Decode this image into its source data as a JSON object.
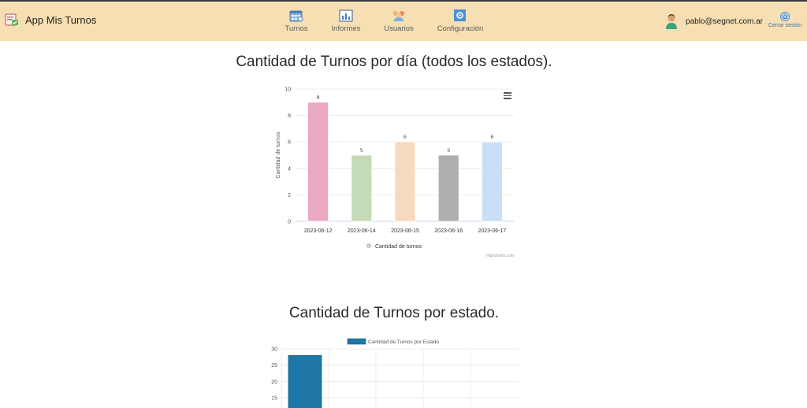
{
  "header": {
    "app_title": "App Mis Turnos",
    "nav": [
      {
        "label": "Turnos",
        "icon": "calendar-icon"
      },
      {
        "label": "Informes",
        "icon": "bar-chart-icon"
      },
      {
        "label": "Usuarios",
        "icon": "users-icon"
      },
      {
        "label": "Configuración",
        "icon": "gear-icon"
      }
    ],
    "user_email": "pablo@segnet.com.ar",
    "logout_label": "Cerrar sesión"
  },
  "colors": {
    "header_bg": "#f7dfb4",
    "link": "#3b6ea8",
    "bar_series2": "#1f77a8"
  },
  "sections": {
    "chart1_title": "Cantidad de Turnos por día (todos los estados).",
    "chart2_title": "Cantidad de Turnos por estado."
  },
  "chart_data": [
    {
      "type": "bar",
      "categories": [
        "2023-06-12",
        "2023-06-14",
        "2023-06-15",
        "2023-06-16",
        "2023-06-17"
      ],
      "series": [
        {
          "name": "Cantidad de turnos",
          "values": [
            9,
            5,
            6,
            5,
            6
          ]
        }
      ],
      "bar_colors": [
        "#e8a9c2",
        "#c5dbb8",
        "#f7d9bf",
        "#aeaeae",
        "#c8e0f5"
      ],
      "data_labels": [
        "9",
        "5",
        "6",
        "5",
        "6"
      ],
      "ylabel": "Cantidad de turnos",
      "yticks": [
        0,
        2,
        4,
        6,
        8,
        10
      ],
      "ylim": [
        0,
        10
      ],
      "credits": "Highcharts.com",
      "legend": "bottom"
    },
    {
      "type": "bar",
      "categories": [],
      "series": [
        {
          "name": "Cantidad de Turnos por Estado",
          "values": [
            28
          ]
        }
      ],
      "yticks": [
        15,
        20,
        25,
        30
      ],
      "ylim": [
        0,
        30
      ],
      "legend": "top"
    }
  ]
}
